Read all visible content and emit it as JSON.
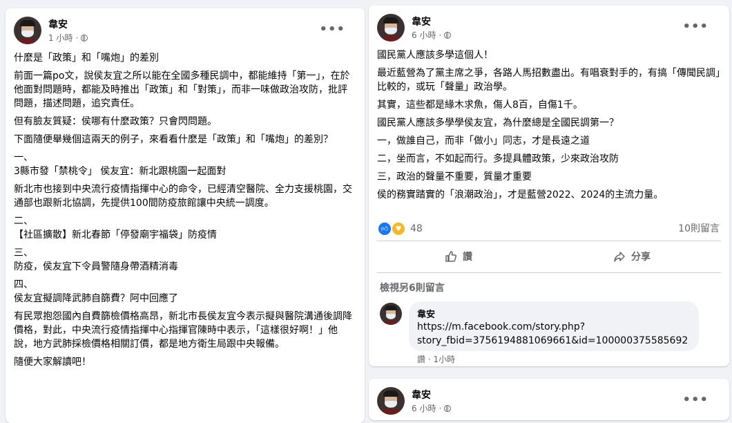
{
  "left_post": {
    "author": "韋安",
    "time": "1 小時",
    "dot": "·",
    "more": "•••",
    "paragraphs": [
      "什麼是「政策」和「嘴炮」的差別",
      "前面一篇po文，說侯友宜之所以能在全國多種民調中，都能維持「第一」，在於他面對問題時，都能及時推出「政策」和「對策」，而非一味做政治攻防，批評問題，描述問題，追究責任。",
      "但有臉友質疑：侯哪有什麼政策？只會閃問題。",
      "下面隨便舉幾個這兩天的例子，來看看什麼是「政策」和「嘴炮」的差別？"
    ],
    "items": [
      {
        "num": "一、",
        "text": "3縣市發「禁桃令」 侯友宜：新北跟桃園一起面對"
      },
      {
        "num": "",
        "text": "新北市也接到中央流行疫情指揮中心的命令，已經清空醫院、全力支援桃園，交通部也跟新北協調，先提供100間防疫旅館讓中央統一調度。"
      },
      {
        "num": "二、",
        "text": "【社區擴散】新北春節「停發廟宇福袋」防疫情"
      },
      {
        "num": "三、",
        "text": "防疫，侯友宜下令員警隨身帶酒精消毒"
      },
      {
        "num": "四、",
        "text": "侯友宜擬調降武肺自篩費？阿中回應了"
      },
      {
        "num": "",
        "text": "有民眾抱怨國內自費篩檢價格高昂，新北市長侯友宜今表示擬與醫院溝通後調降價格，對此，中央流行疫情指揮中心指揮官陳時中表示，「這樣很好啊！」他說，地方武肺採檢價格相關訂價，都是地方衛生局跟中央報備。"
      },
      {
        "num": "",
        "text": "隨便大家解讀吧！"
      }
    ]
  },
  "right_post": {
    "author": "韋安",
    "time": "6 小時",
    "dot": "·",
    "more": "•••",
    "paragraphs": [
      "國民黨人應該多學這個人！",
      "最近藍營為了黨主席之爭，各路人馬招數盡出。有唱衰對手的，有搞「傳聞民調」比較的，或玩「聲量」政治學。",
      "其實，這些都是緣木求魚，傷人8百，自傷1千。",
      "國民黨人應該多學學侯友宜，為什麼總是全國民調第一？",
      "一，做誰自己，而非「做小」同志，才是長遠之道",
      "二，坐而言，不如起而行。多提具體政策，少來政治攻防",
      "三，政治的聲量不重要，質量才重要",
      "侯的務實踏實的「浪潮政治」，才是藍營2022、2024的主流力量。"
    ],
    "reaction_count": "48",
    "comment_count": "10則留言",
    "like_label": "讚",
    "share_label": "分享",
    "view_more": "檢視另6則留言",
    "comment": {
      "author": "韋安",
      "text": "https://m.facebook.com/story.php?story_fbid=3756194881069661&id=100000375585692",
      "like": "讚",
      "time": "1小時"
    }
  },
  "third_post": {
    "author": "韋安",
    "time": "6 小時",
    "dot": "·",
    "more": "•••"
  },
  "colors": {
    "accent": "#1877f2",
    "secondary_text": "#65676b",
    "background": "#f0f2f5"
  },
  "icons": {
    "globe": "globe-icon",
    "like": "thumbs-up-icon",
    "share": "share-arrow-icon",
    "care": "care-emoji-icon"
  }
}
